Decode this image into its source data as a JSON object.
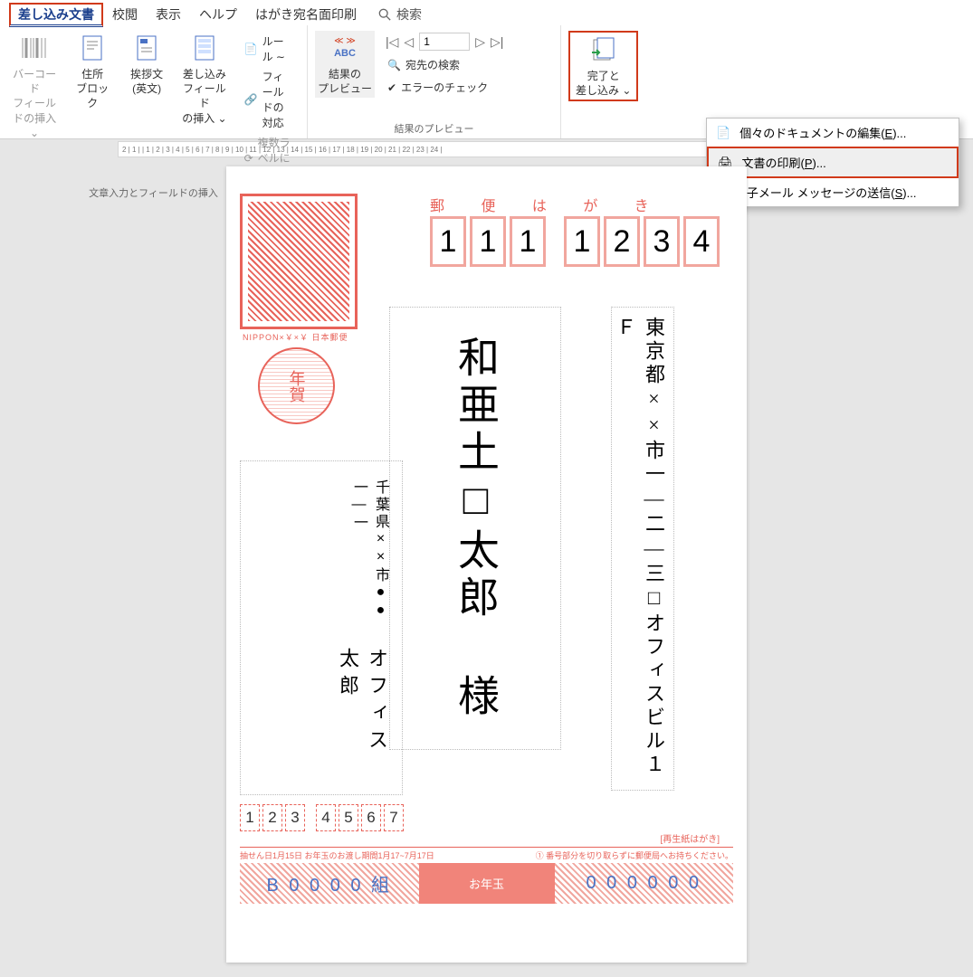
{
  "tabs": {
    "mailmerge": "差し込み文書",
    "review": "校閲",
    "view": "表示",
    "help": "ヘルプ",
    "postcard": "はがき宛名面印刷",
    "search": "検索"
  },
  "ribbon": {
    "barcode": "バーコード\nフィールドの挿入 ⌄",
    "address_block": "住所\nブロック",
    "greeting": "挨拶文\n(英文)",
    "insert_field": "差し込みフィールド\nの挿入 ⌄",
    "rules": "ルール ∼",
    "match_fields": "フィールドの対応",
    "update_labels": "複数ラベルに反映",
    "preview": "結果の\nプレビュー",
    "abc": "ABC",
    "find_recipient": "宛先の検索",
    "check_errors": "エラーのチェック",
    "record_value": "1",
    "finish": "完了と\n差し込み ⌄",
    "group1": "文章入力とフィールドの挿入",
    "group2": "結果のプレビュー"
  },
  "dropdown": {
    "edit_docs": "個々のドキュメントの編集(",
    "edit_docs_key": "E",
    "edit_docs_tail": ")...",
    "print": "文書の印刷(",
    "print_key": "P",
    "print_tail": ")...",
    "email": "電子メール メッセージの送信(",
    "email_key": "S",
    "email_tail": ")..."
  },
  "ruler": "2 | 1 |   | 1 | 2 | 3 | 4 | 5 | 6 | 7 | 8 | 9 | 10 | 11 | 12 | 13 | 14 | 15 | 16 | 17 | 18 | 19 | 20 | 21 | 22 | 23 | 24 |",
  "postcard": {
    "yubin": "郵 便 は が き",
    "stamp_foot": "NIPPON×￥×￥ 日本郵便",
    "nenga": "年賀",
    "postal": [
      "1",
      "1",
      "1",
      "1",
      "2",
      "3",
      "4"
    ],
    "address": "東京都××市一―二―三□オフィスビル１Ｆ",
    "recipient": "和亜土□太郎 様",
    "sender_addr": "千葉県××市●●一―一",
    "sender_name": "オフィス太郎",
    "sender_postal": [
      "1",
      "2",
      "3",
      "4",
      "5",
      "6",
      "7"
    ],
    "recycle": "[再生紙はがき]",
    "footer_left": "抽せん日1月15日  お年玉のお渡し期間1月17~7月17日",
    "footer_right": "① 番号部分を切り取らずに郵便局へお持ちください。",
    "lottery_left": "B 0 0 0 0 組",
    "lottery_mid": "お年玉",
    "lottery_right": "0 0 0 0 0 0"
  }
}
